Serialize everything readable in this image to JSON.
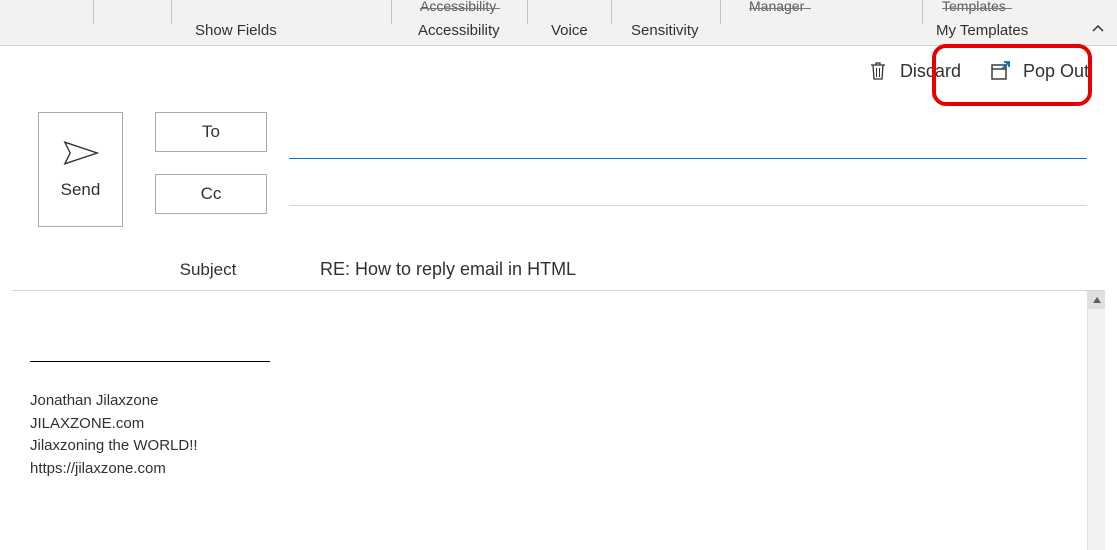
{
  "ribbon": {
    "show_fields": "Show Fields",
    "accessibility_top": "Accessibility",
    "accessibility": "Accessibility",
    "voice": "Voice",
    "sensitivity": "Sensitivity",
    "manager_top": "Manager",
    "templates_top": "Templates",
    "my_templates": "My Templates"
  },
  "actions": {
    "discard": "Discard",
    "pop_out": "Pop Out"
  },
  "compose": {
    "send": "Send",
    "to_btn": "To",
    "cc_btn": "Cc",
    "to_value": "",
    "subject_label": "Subject",
    "subject_value": "RE: How to reply email in HTML"
  },
  "signature": {
    "line1": "Jonathan Jilaxzone",
    "line2": "JILAXZONE.com",
    "line3": "Jilaxzoning the WORLD!!",
    "line4": "https://jilaxzone.com"
  }
}
